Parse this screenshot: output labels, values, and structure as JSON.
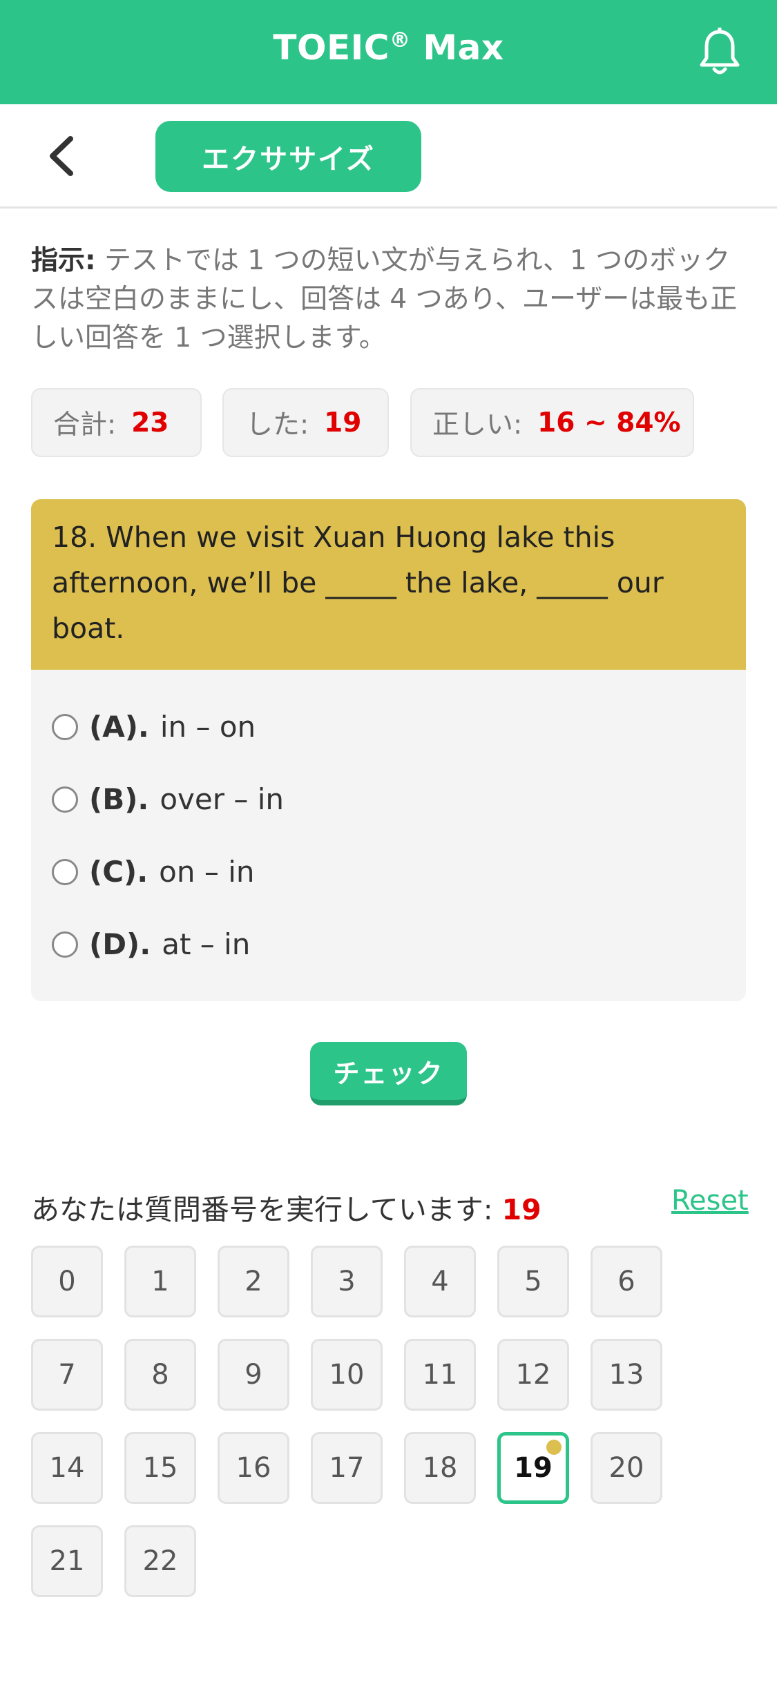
{
  "header": {
    "title": "TOEIC",
    "title_mark": "®",
    "title_suffix": " Max"
  },
  "nav": {
    "exercise_label": "エクササイズ"
  },
  "instruction": {
    "label": "指示:",
    "text": " テストでは 1 つの短い文が与えられ、1 つのボックスは空白のままにし、回答は 4 つあり、ユーザーは最も正しい回答を 1 つ選択します。"
  },
  "stats": [
    {
      "label": "合計:",
      "value": "23"
    },
    {
      "label": "した:",
      "value": "19"
    },
    {
      "label": "正しい:",
      "value": "16 ~ 84%"
    }
  ],
  "question": {
    "text": "18. When we visit Xuan Huong lake this afternoon, we’ll be _____ the lake, _____ our boat.",
    "options": [
      {
        "letter": "(A).",
        "text": "in – on"
      },
      {
        "letter": "(B).",
        "text": "over – in"
      },
      {
        "letter": "(C).",
        "text": "on – in"
      },
      {
        "letter": "(D).",
        "text": "at – in"
      }
    ]
  },
  "check_label": "チェック",
  "progress": {
    "label": "あなたは質問番号を実行しています: ",
    "current": "19",
    "reset_label": "Reset"
  },
  "grid": [
    "0",
    "1",
    "2",
    "3",
    "4",
    "5",
    "6",
    "7",
    "8",
    "9",
    "10",
    "11",
    "12",
    "13",
    "14",
    "15",
    "16",
    "17",
    "18",
    "19",
    "20",
    "21",
    "22"
  ],
  "colors": {
    "primary": "#2dc48a",
    "question_header": "#dcbf4f",
    "accent_red": "#e00000"
  }
}
